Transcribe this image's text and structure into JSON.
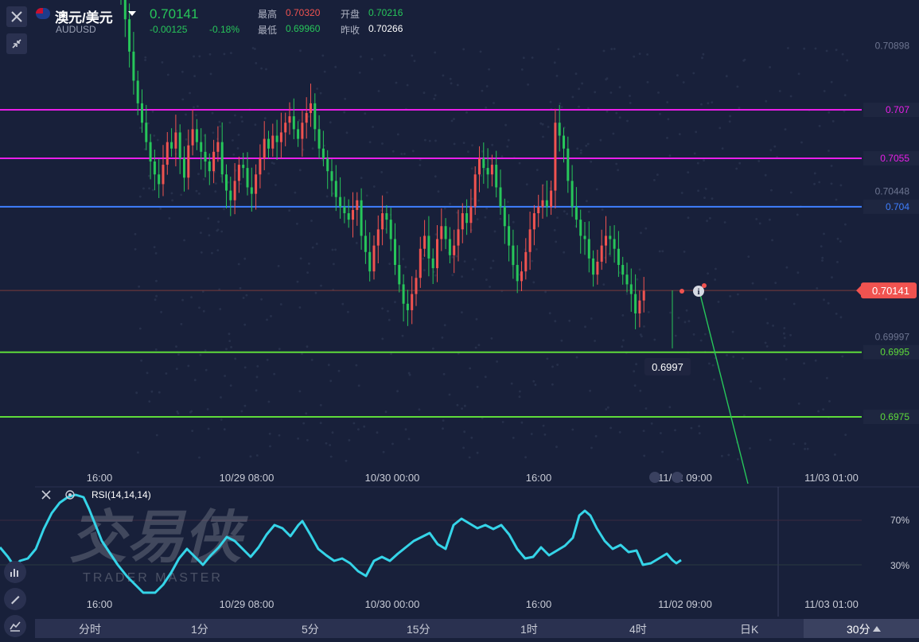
{
  "header": {
    "pair_name": "澳元/美元",
    "pair_code": "AUDUSD",
    "last_price": "0.70141",
    "change": "-0.00125",
    "change_pct": "-0.18%",
    "stats": [
      {
        "label": "最高",
        "value": "0.70320",
        "color": "#f05350"
      },
      {
        "label": "开盘",
        "value": "0.70216",
        "color": "#27c65a"
      },
      {
        "label": "最低",
        "value": "0.69960",
        "color": "#27c65a"
      },
      {
        "label": "昨收",
        "value": "0.70266",
        "color": "#ffffff"
      }
    ]
  },
  "price_axis": {
    "ticks": [
      "0.70898",
      "0.70448",
      "0.69997"
    ],
    "levels": [
      {
        "value": "0.707",
        "color": "#e91fe9"
      },
      {
        "value": "0.7055",
        "color": "#e91fe9"
      },
      {
        "value": "0.704",
        "color": "#3f7fff"
      },
      {
        "value": "0.6995",
        "color": "#5edb3a"
      },
      {
        "value": "0.6975",
        "color": "#5edb3a"
      }
    ],
    "current_price": "0.70141",
    "low_marker": "0.6997"
  },
  "time_axis": {
    "main": [
      "16:00",
      "10/29 08:00",
      "10/30 00:00",
      "16:00",
      "11/02 09:00",
      "11/03 01:00"
    ],
    "rsi": [
      "16:00",
      "10/29 08:00",
      "10/30 00:00",
      "16:00",
      "11/02 09:00",
      "11/03 01:00"
    ]
  },
  "rsi": {
    "label": "RSI(14,14,14)",
    "levels": [
      "70%",
      "30%"
    ],
    "color": "#35d4e8"
  },
  "watermark": {
    "text": "交易侠",
    "sub": "TRADER MASTER"
  },
  "timeframes": [
    "分时",
    "1分",
    "5分",
    "15分",
    "1时",
    "4时",
    "日K",
    "30分"
  ],
  "colors": {
    "up": "#f05350",
    "down": "#27c65a",
    "bg": "#18203a",
    "grid": "#2a3150"
  }
}
